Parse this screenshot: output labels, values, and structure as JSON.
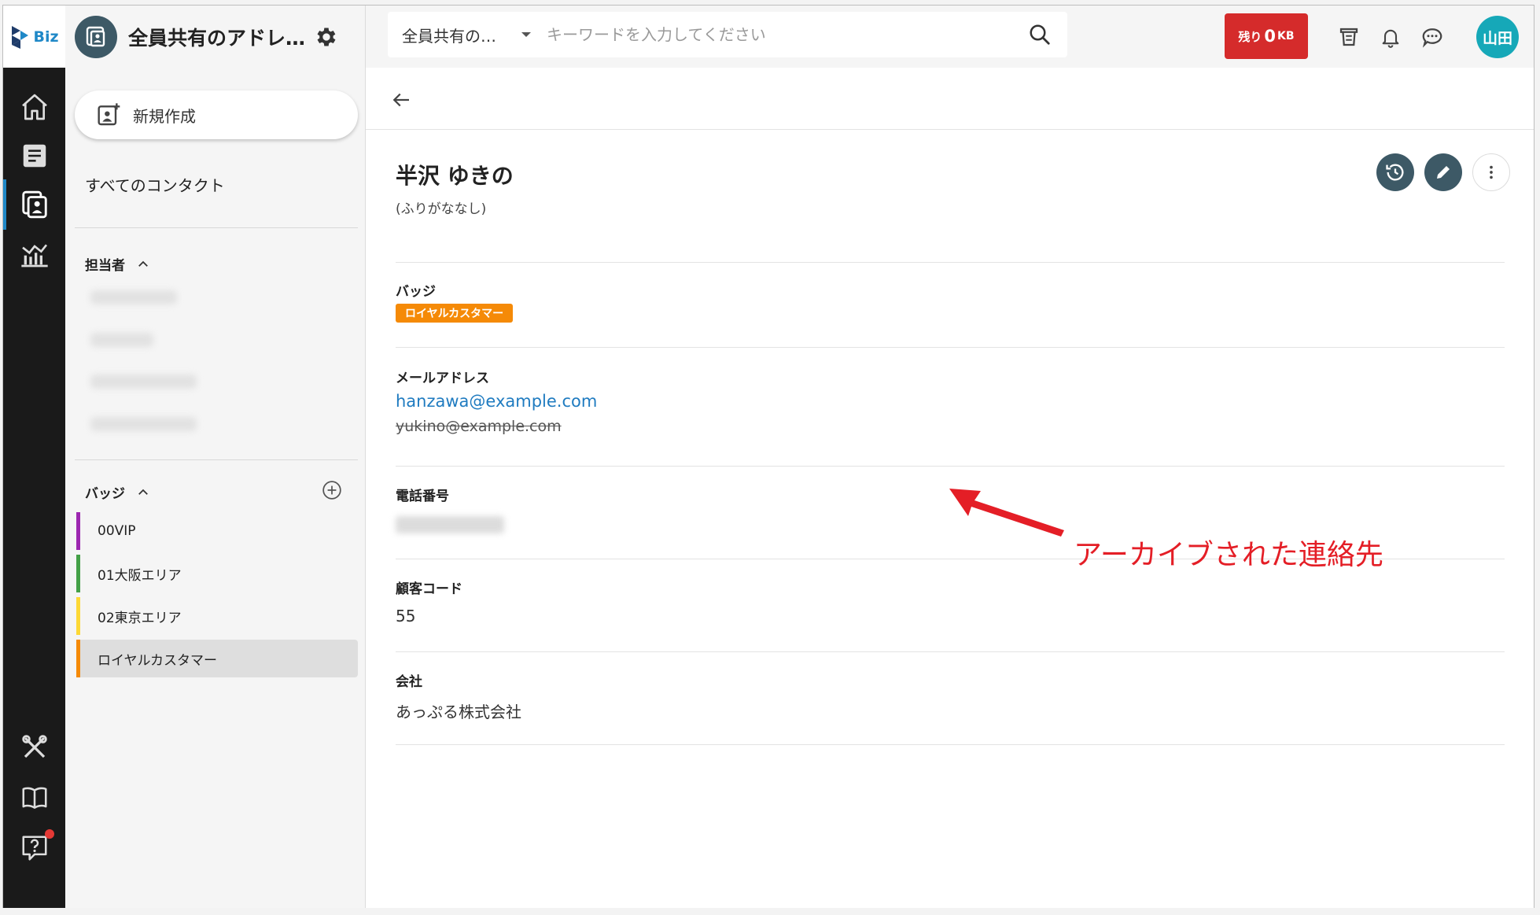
{
  "app": {
    "logo_text": "Biz",
    "title": "全員共有のアドレス帳",
    "title_display": "全員共有のアドレ…"
  },
  "search": {
    "scope": "全員共有の…",
    "placeholder": "キーワードを入力してください"
  },
  "storage": {
    "label": "残り",
    "value": "0",
    "unit": "KB"
  },
  "user": {
    "avatar_text": "山田"
  },
  "sidebar": {
    "new_button": "新規作成",
    "all_contacts": "すべてのコンタクト",
    "owner_section": "担当者",
    "badge_section": "バッジ",
    "badges": [
      {
        "label": "00VIP",
        "color": "#9c27b0"
      },
      {
        "label": "01大阪エリア",
        "color": "#43a047"
      },
      {
        "label": "02東京エリア",
        "color": "#fdd835"
      },
      {
        "label": "ロイヤルカスタマー",
        "color": "#f58a07"
      }
    ]
  },
  "contact": {
    "name": "半沢 ゆきの",
    "kana": "(ふりがななし)",
    "badge_label": "バッジ",
    "badge_value": "ロイヤルカスタマー",
    "email_label": "メールアドレス",
    "email_primary": "hanzawa@example.com",
    "email_archived": "yukino@example.com",
    "phone_label": "電話番号",
    "customer_code_label": "顧客コード",
    "customer_code": "55",
    "company_label": "会社",
    "company": "あっぷる株式会社"
  },
  "annotation": {
    "text": "アーカイブされた連絡先",
    "color": "#e41e26"
  },
  "colors": {
    "accent": "#1f88c7",
    "storage_red": "#d52b2b",
    "avatar": "#16a8b8",
    "dark_button": "#3d5966"
  }
}
